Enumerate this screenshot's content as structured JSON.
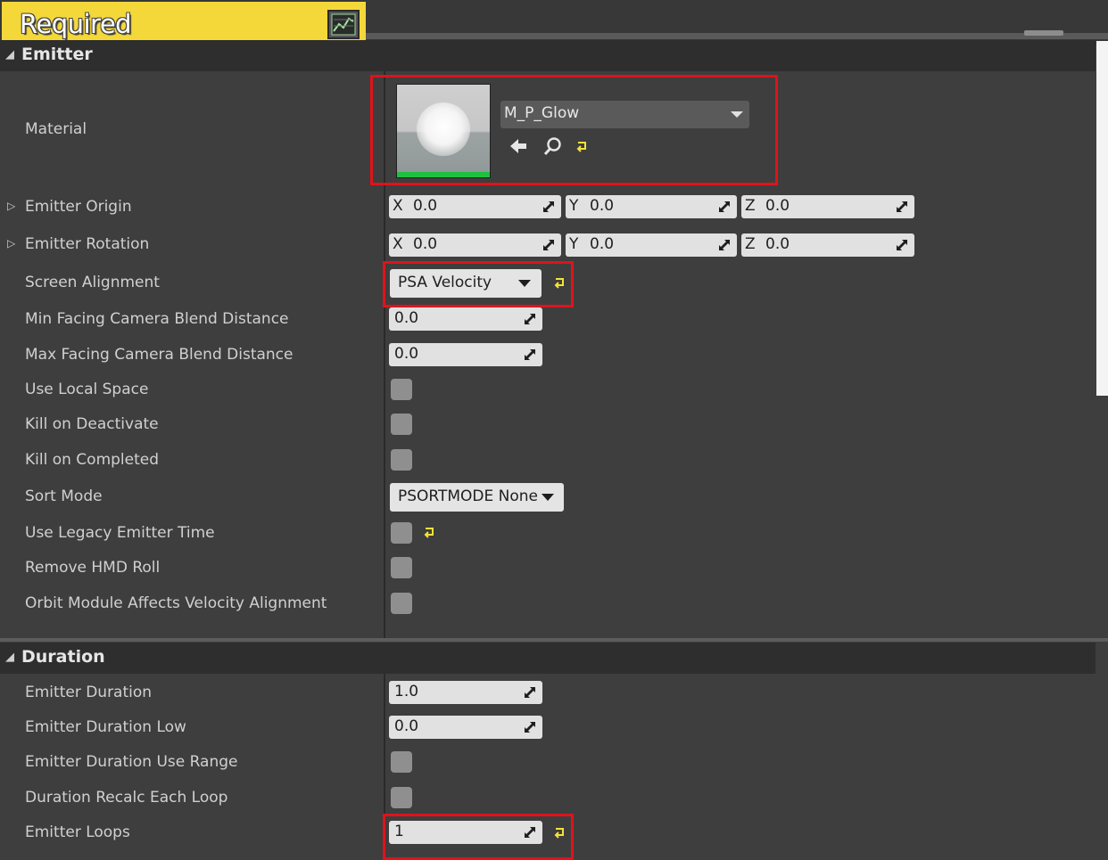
{
  "header": {
    "title": "Required",
    "curve_icon": "curve-editor-icon"
  },
  "emitter": {
    "title": "Emitter",
    "material": {
      "label": "Material",
      "value": "M_P_Glow",
      "icons": [
        "use-selected-arrow-icon",
        "browse-search-icon",
        "reset-to-default-icon"
      ]
    },
    "origin": {
      "label": "Emitter Origin",
      "x_axis": "X",
      "x": "0.0",
      "y_axis": "Y",
      "y": "0.0",
      "z_axis": "Z",
      "z": "0.0"
    },
    "rotation": {
      "label": "Emitter Rotation",
      "x_axis": "X",
      "x": "0.0",
      "y_axis": "Y",
      "y": "0.0",
      "z_axis": "Z",
      "z": "0.0"
    },
    "screen_alignment": {
      "label": "Screen Alignment",
      "value": "PSA Velocity"
    },
    "min_facing": {
      "label": "Min Facing Camera Blend Distance",
      "value": "0.0"
    },
    "max_facing": {
      "label": "Max Facing Camera Blend Distance",
      "value": "0.0"
    },
    "use_local_space": {
      "label": "Use Local Space",
      "checked": false
    },
    "kill_on_deactivate": {
      "label": "Kill on Deactivate",
      "checked": false
    },
    "kill_on_completed": {
      "label": "Kill on Completed",
      "checked": false
    },
    "sort_mode": {
      "label": "Sort Mode",
      "value": "PSORTMODE None"
    },
    "legacy_time": {
      "label": "Use Legacy Emitter Time",
      "checked": false
    },
    "remove_hmd_roll": {
      "label": "Remove HMD Roll",
      "checked": false
    },
    "orbit_module": {
      "label": "Orbit Module Affects Velocity Alignment",
      "checked": false
    }
  },
  "duration": {
    "title": "Duration",
    "emitter_duration": {
      "label": "Emitter Duration",
      "value": "1.0"
    },
    "emitter_duration_low": {
      "label": "Emitter Duration Low",
      "value": "0.0"
    },
    "use_range": {
      "label": "Emitter Duration Use Range",
      "checked": false
    },
    "recalc_each_loop": {
      "label": "Duration Recalc Each Loop",
      "checked": false
    },
    "emitter_loops": {
      "label": "Emitter Loops",
      "value": "1"
    }
  },
  "colors": {
    "panel_bg": "#3e3e3e",
    "header_yellow": "#f4d83a",
    "highlight_red": "#e0121b",
    "reset_yellow": "#f4e23a",
    "thumb_strip_green": "#1dc13e"
  }
}
